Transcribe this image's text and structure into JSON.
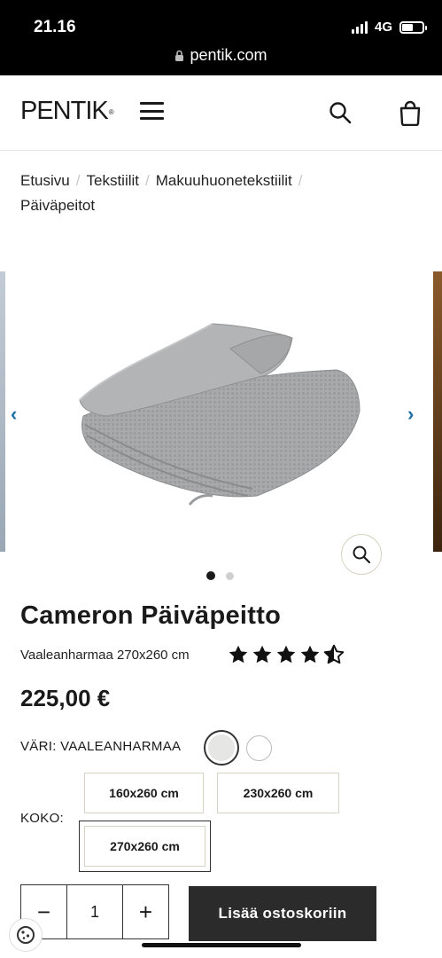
{
  "status_bar": {
    "time": "21.16",
    "network": "4G",
    "url": "pentik.com",
    "battery_level": 0.55
  },
  "header": {
    "logo": "PENTIK",
    "logo_mark": "®",
    "icons": [
      "menu-icon",
      "search-icon",
      "shopping-bag-icon"
    ]
  },
  "breadcrumb": {
    "items": [
      "Etusivu",
      "Tekstiilit",
      "Makuuhuonetekstiilit",
      "Päiväpeitot"
    ],
    "separator": "/"
  },
  "gallery": {
    "prev_arrow": "‹",
    "next_arrow": "›",
    "slide_count": 2,
    "active_slide": 1
  },
  "product": {
    "title": "Cameron Päiväpeitto",
    "subtitle": "Vaaleanharmaa 270x260 cm",
    "rating": 4.5,
    "rating_max": 5,
    "price": "225,00 €",
    "color_label": "VÄRI: VAALEANHARMAA",
    "colors": [
      {
        "hex": "#e6e6e4",
        "selected": true
      },
      {
        "hex": "#ffffff",
        "selected": false
      }
    ],
    "size_label": "KOKO:",
    "sizes": [
      {
        "label": "160x260 cm",
        "selected": false
      },
      {
        "label": "230x260 cm",
        "selected": false
      },
      {
        "label": "270x260 cm",
        "selected": true
      }
    ]
  },
  "purchase": {
    "minus": "−",
    "quantity": "1",
    "plus": "+",
    "add_to_cart": "Lisää ostoskoriin"
  },
  "colors": {
    "status_bar_bg": "#000000",
    "cart_button_bg": "#2b2b2b",
    "arrow": "#1e6fa8",
    "border": "#d6d3c4"
  }
}
